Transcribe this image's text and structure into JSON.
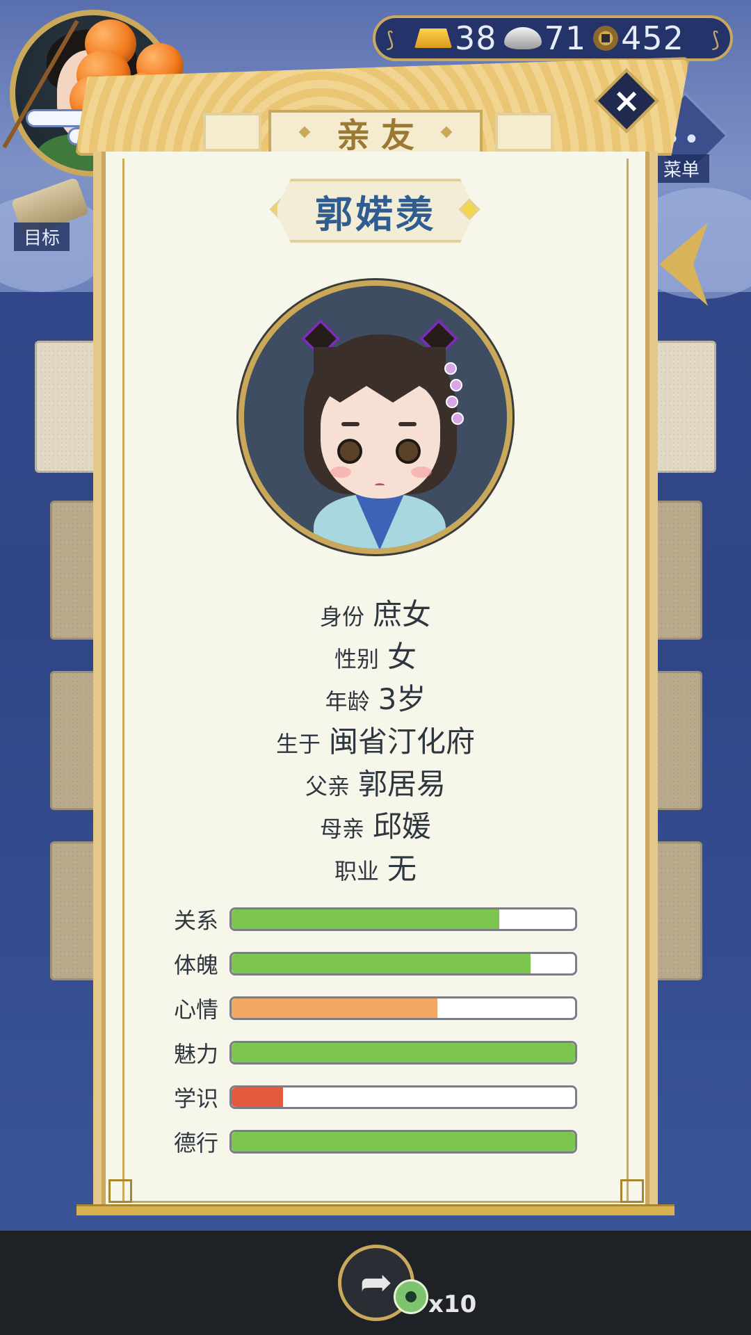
{
  "hud": {
    "currencies": [
      {
        "icon": "gold-ingot-icon",
        "value": "38"
      },
      {
        "icon": "silver-ingot-icon",
        "value": "71"
      },
      {
        "icon": "copper-coin-icon",
        "value": "452"
      }
    ],
    "goal_label": "目标",
    "menu_label": "菜单"
  },
  "panel": {
    "title": "亲友",
    "name": "郭婼羡",
    "info": [
      {
        "key": "身份",
        "value": "庶女"
      },
      {
        "key": "性别",
        "value": "女"
      },
      {
        "key": "年龄",
        "value": "3岁"
      },
      {
        "key": "生于",
        "value": "闽省汀化府"
      },
      {
        "key": "父亲",
        "value": "郭居易"
      },
      {
        "key": "母亲",
        "value": "邱媛"
      },
      {
        "key": "职业",
        "value": "无"
      }
    ],
    "stats": [
      {
        "label": "关系",
        "value": 0.78,
        "color": "#7cc54e"
      },
      {
        "label": "体魄",
        "value": 0.87,
        "color": "#7cc54e"
      },
      {
        "label": "心情",
        "value": 0.6,
        "color": "#f0a862"
      },
      {
        "label": "魅力",
        "value": 1.0,
        "color": "#7cc54e"
      },
      {
        "label": "学识",
        "value": 0.15,
        "color": "#e45a3c"
      },
      {
        "label": "德行",
        "value": 1.0,
        "color": "#7cc54e"
      }
    ]
  },
  "footer": {
    "share_icon": "share-icon",
    "token_count": "x10"
  },
  "colors": {
    "accent_gold": "#caa95c",
    "name_blue": "#2f5d8f",
    "bar_green": "#7cc54e",
    "bar_orange": "#f0a862",
    "bar_red": "#e45a3c"
  }
}
